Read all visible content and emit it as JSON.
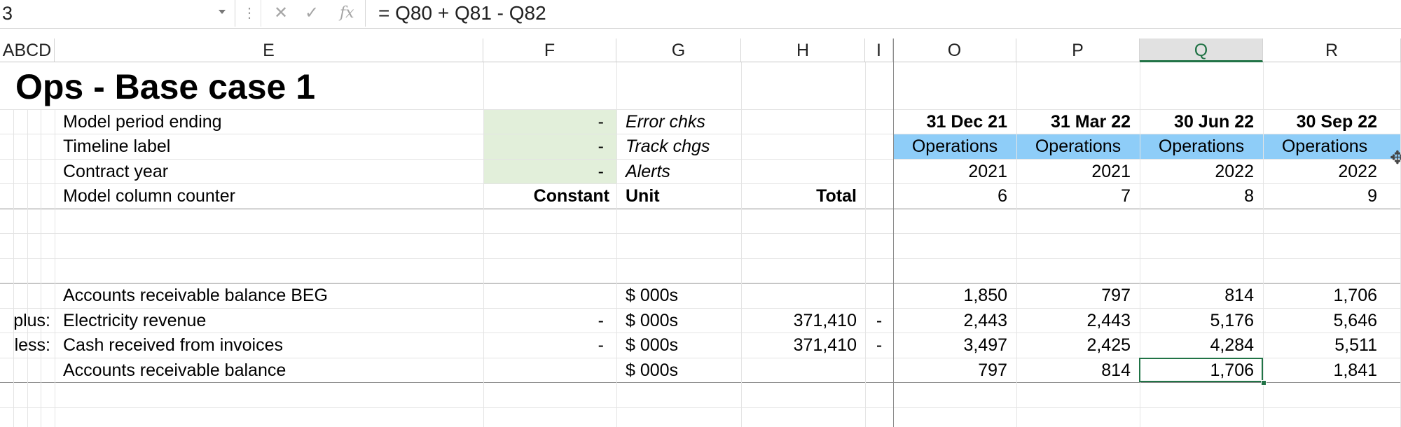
{
  "formula_bar": {
    "name_box": "3",
    "formula": "= Q80 + Q81 - Q82",
    "cancel_glyph": "✕",
    "enter_glyph": "✓",
    "fx_glyph": "fx"
  },
  "columns": [
    "ABCD",
    "E",
    "F",
    "G",
    "H",
    "I",
    "O",
    "P",
    "Q",
    "R"
  ],
  "selected_column": "Q",
  "title": "Ops - Base case 1",
  "header_rows": [
    {
      "label": "Model period ending",
      "f": "-",
      "g": "Error chks",
      "dates": [
        "31 Dec 21",
        "31 Mar 22",
        "30 Jun 22",
        "30 Sep 22"
      ]
    },
    {
      "label": "Timeline label",
      "f": "-",
      "g": "Track chgs",
      "dates": [
        "Operations",
        "Operations",
        "Operations",
        "Operations"
      ]
    },
    {
      "label": "Contract year",
      "f": "-",
      "g": "Alerts",
      "dates": [
        "2021",
        "2021",
        "2022",
        "2022"
      ]
    },
    {
      "label": "Model column counter",
      "f": "Constant",
      "g": "Unit",
      "h": "Total",
      "dates": [
        "6",
        "7",
        "8",
        "9"
      ]
    }
  ],
  "data_rows": [
    {
      "prefix": "",
      "label": "Accounts receivable balance BEG",
      "f": "",
      "unit": "$ 000s",
      "total": "",
      "i": "",
      "values": [
        "1,850",
        "797",
        "814",
        "1,706"
      ]
    },
    {
      "prefix": "plus:",
      "label": "Electricity revenue",
      "f": "-",
      "unit": "$ 000s",
      "total": "371,410",
      "i": "-",
      "values": [
        "2,443",
        "2,443",
        "5,176",
        "5,646"
      ]
    },
    {
      "prefix": "less:",
      "label": "Cash received from invoices",
      "f": "-",
      "unit": "$ 000s",
      "total": "371,410",
      "i": "-",
      "values": [
        "3,497",
        "2,425",
        "4,284",
        "5,511"
      ]
    },
    {
      "prefix": "",
      "label": "Accounts receivable balance",
      "f": "",
      "unit": "$ 000s",
      "total": "",
      "i": "",
      "values": [
        "797",
        "814",
        "1,706",
        "1,841"
      ]
    }
  ],
  "colors": {
    "input_fill": "#e2efda",
    "timeline_fill": "#8ecdf8",
    "selection": "#217346"
  }
}
